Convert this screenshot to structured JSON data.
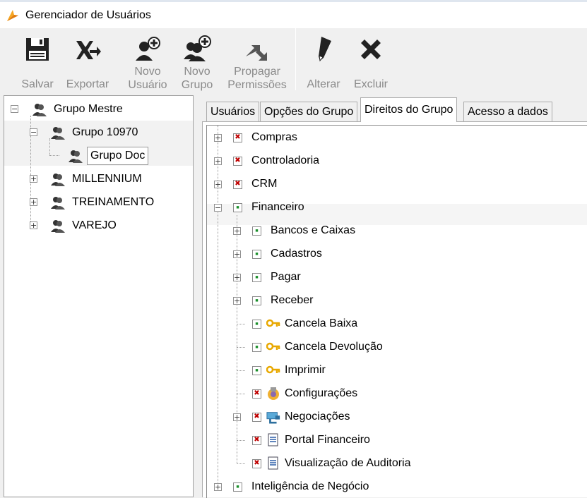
{
  "window": {
    "title": "Gerenciador de Usuários"
  },
  "toolbar": {
    "buttons": [
      {
        "label": "Salvar",
        "icon": "save-icon"
      },
      {
        "label": "Exportar",
        "icon": "export-icon"
      },
      {
        "label": "Novo\nUsuário",
        "icon": "new-user-icon"
      },
      {
        "label": "Novo\nGrupo",
        "icon": "new-group-icon"
      },
      {
        "label": "Propagar\nPermissões",
        "icon": "propagate-icon"
      },
      {
        "label": "Alterar",
        "icon": "pencil-icon"
      },
      {
        "label": "Excluir",
        "icon": "delete-icon"
      }
    ]
  },
  "group_tree": {
    "root": "Grupo Mestre",
    "items": [
      {
        "label": "Grupo 10970",
        "expanded": true
      },
      {
        "label": "Grupo Doc",
        "selected": true
      },
      {
        "label": "MILLENNIUM",
        "expanded": false
      },
      {
        "label": "TREINAMENTO",
        "expanded": false
      },
      {
        "label": "VAREJO",
        "expanded": false
      }
    ]
  },
  "tabs": [
    {
      "label": "Usuários"
    },
    {
      "label": "Opções do Grupo"
    },
    {
      "label": "Direitos do Grupo",
      "active": true
    },
    {
      "label": "Acesso a dados"
    }
  ],
  "rights_tree": [
    {
      "label": "Compras",
      "checked": false,
      "expandable": true
    },
    {
      "label": "Controladoria",
      "checked": false,
      "expandable": true
    },
    {
      "label": "CRM",
      "checked": false,
      "expandable": true
    },
    {
      "label": "Financeiro",
      "checked": true,
      "expandable": true,
      "expanded": true
    },
    {
      "label": "Bancos e Caixas",
      "checked": true,
      "expandable": true
    },
    {
      "label": "Cadastros",
      "checked": true,
      "expandable": true
    },
    {
      "label": "Pagar",
      "checked": true,
      "expandable": true
    },
    {
      "label": "Receber",
      "checked": true,
      "expandable": true
    },
    {
      "label": "Cancela Baixa",
      "checked": true,
      "icon": "key-icon"
    },
    {
      "label": "Cancela Devolução",
      "checked": true,
      "icon": "key-icon"
    },
    {
      "label": "Imprimir",
      "checked": true,
      "icon": "key-icon"
    },
    {
      "label": "Configurações",
      "checked": false,
      "icon": "settings-icon"
    },
    {
      "label": "Negociações",
      "checked": false,
      "expandable": true,
      "icon": "handshake-icon"
    },
    {
      "label": "Portal Financeiro",
      "checked": false,
      "icon": "document-icon"
    },
    {
      "label": "Visualização de Auditoria",
      "checked": false,
      "icon": "document-icon"
    },
    {
      "label": "Inteligência de Negócio",
      "checked": true,
      "expandable": true
    }
  ],
  "colors": {
    "accent_orange": "#f5a623",
    "check_red": "#c00000",
    "check_green": "#1a8f2a"
  }
}
